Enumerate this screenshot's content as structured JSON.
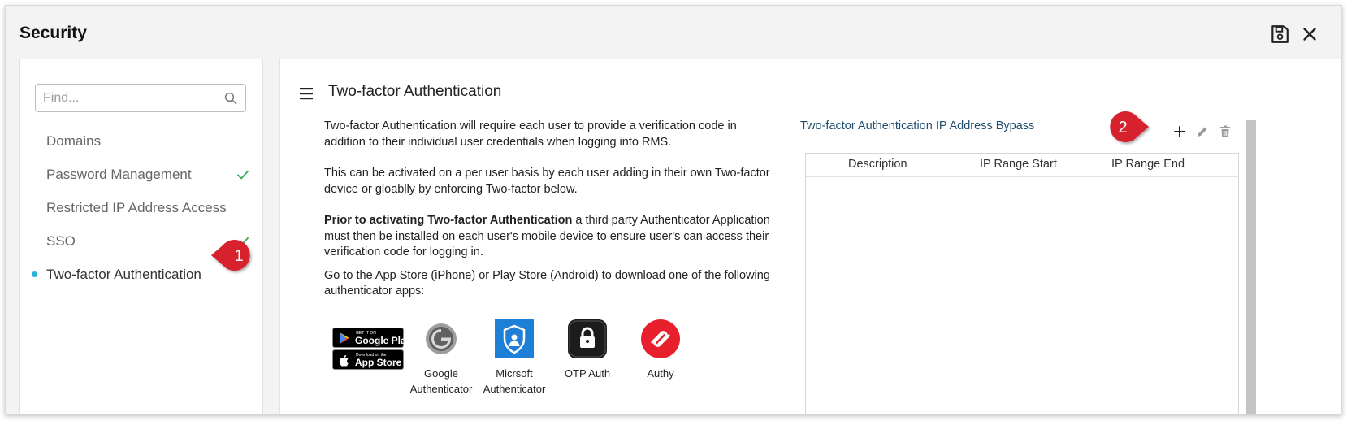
{
  "window": {
    "title": "Security",
    "save_icon": "save-icon",
    "close_icon": "close-icon"
  },
  "sidebar": {
    "search_placeholder": "Find...",
    "items": [
      {
        "label": "Domains",
        "checked": false,
        "active": false
      },
      {
        "label": "Password Management",
        "checked": true,
        "active": false
      },
      {
        "label": "Restricted IP Address Access",
        "checked": false,
        "active": false
      },
      {
        "label": "SSO",
        "checked": true,
        "active": false
      },
      {
        "label": "Two-factor Authentication",
        "checked": false,
        "active": true
      }
    ]
  },
  "callouts": [
    {
      "number": "1"
    },
    {
      "number": "2"
    }
  ],
  "main": {
    "title": "Two-factor Authentication",
    "paragraphs": {
      "p1": "Two-factor Authentication will require each user to provide a verification code in addition to their individual user credentials when logging into RMS.",
      "p2": "This can be activated on a per user basis by each user adding in their own Two-factor device or gloablly by enforcing Two-factor below.",
      "p3_bold": "Prior to activating Two-factor Authentication",
      "p3_rest": " a third party Authenticator Application must then be installed on each user's mobile device to ensure user's can access their verification code for logging in.",
      "p4": "Go to the App Store (iPhone) or Play Store (Android) to download one of the following authenticator apps:"
    },
    "stores": {
      "google_small": "GET IT ON",
      "google_big": "Google Play",
      "apple_small": "Download on the",
      "apple_big": "App Store"
    },
    "apps": [
      {
        "line1": "Google",
        "line2": "Authenticator"
      },
      {
        "line1": "Micrsoft",
        "line2": "Authenticator"
      },
      {
        "line1": "OTP Auth",
        "line2": ""
      },
      {
        "line1": "Authy",
        "line2": ""
      }
    ],
    "bypass": {
      "title": "Two-factor Authentication IP Address Bypass",
      "columns": [
        "Description",
        "IP Range Start",
        "IP Range End"
      ],
      "rows": []
    }
  },
  "colors": {
    "accent": "#2ab3d8",
    "callout": "#d7202f",
    "check": "#3aa757",
    "link_title": "#1f4e6e"
  }
}
